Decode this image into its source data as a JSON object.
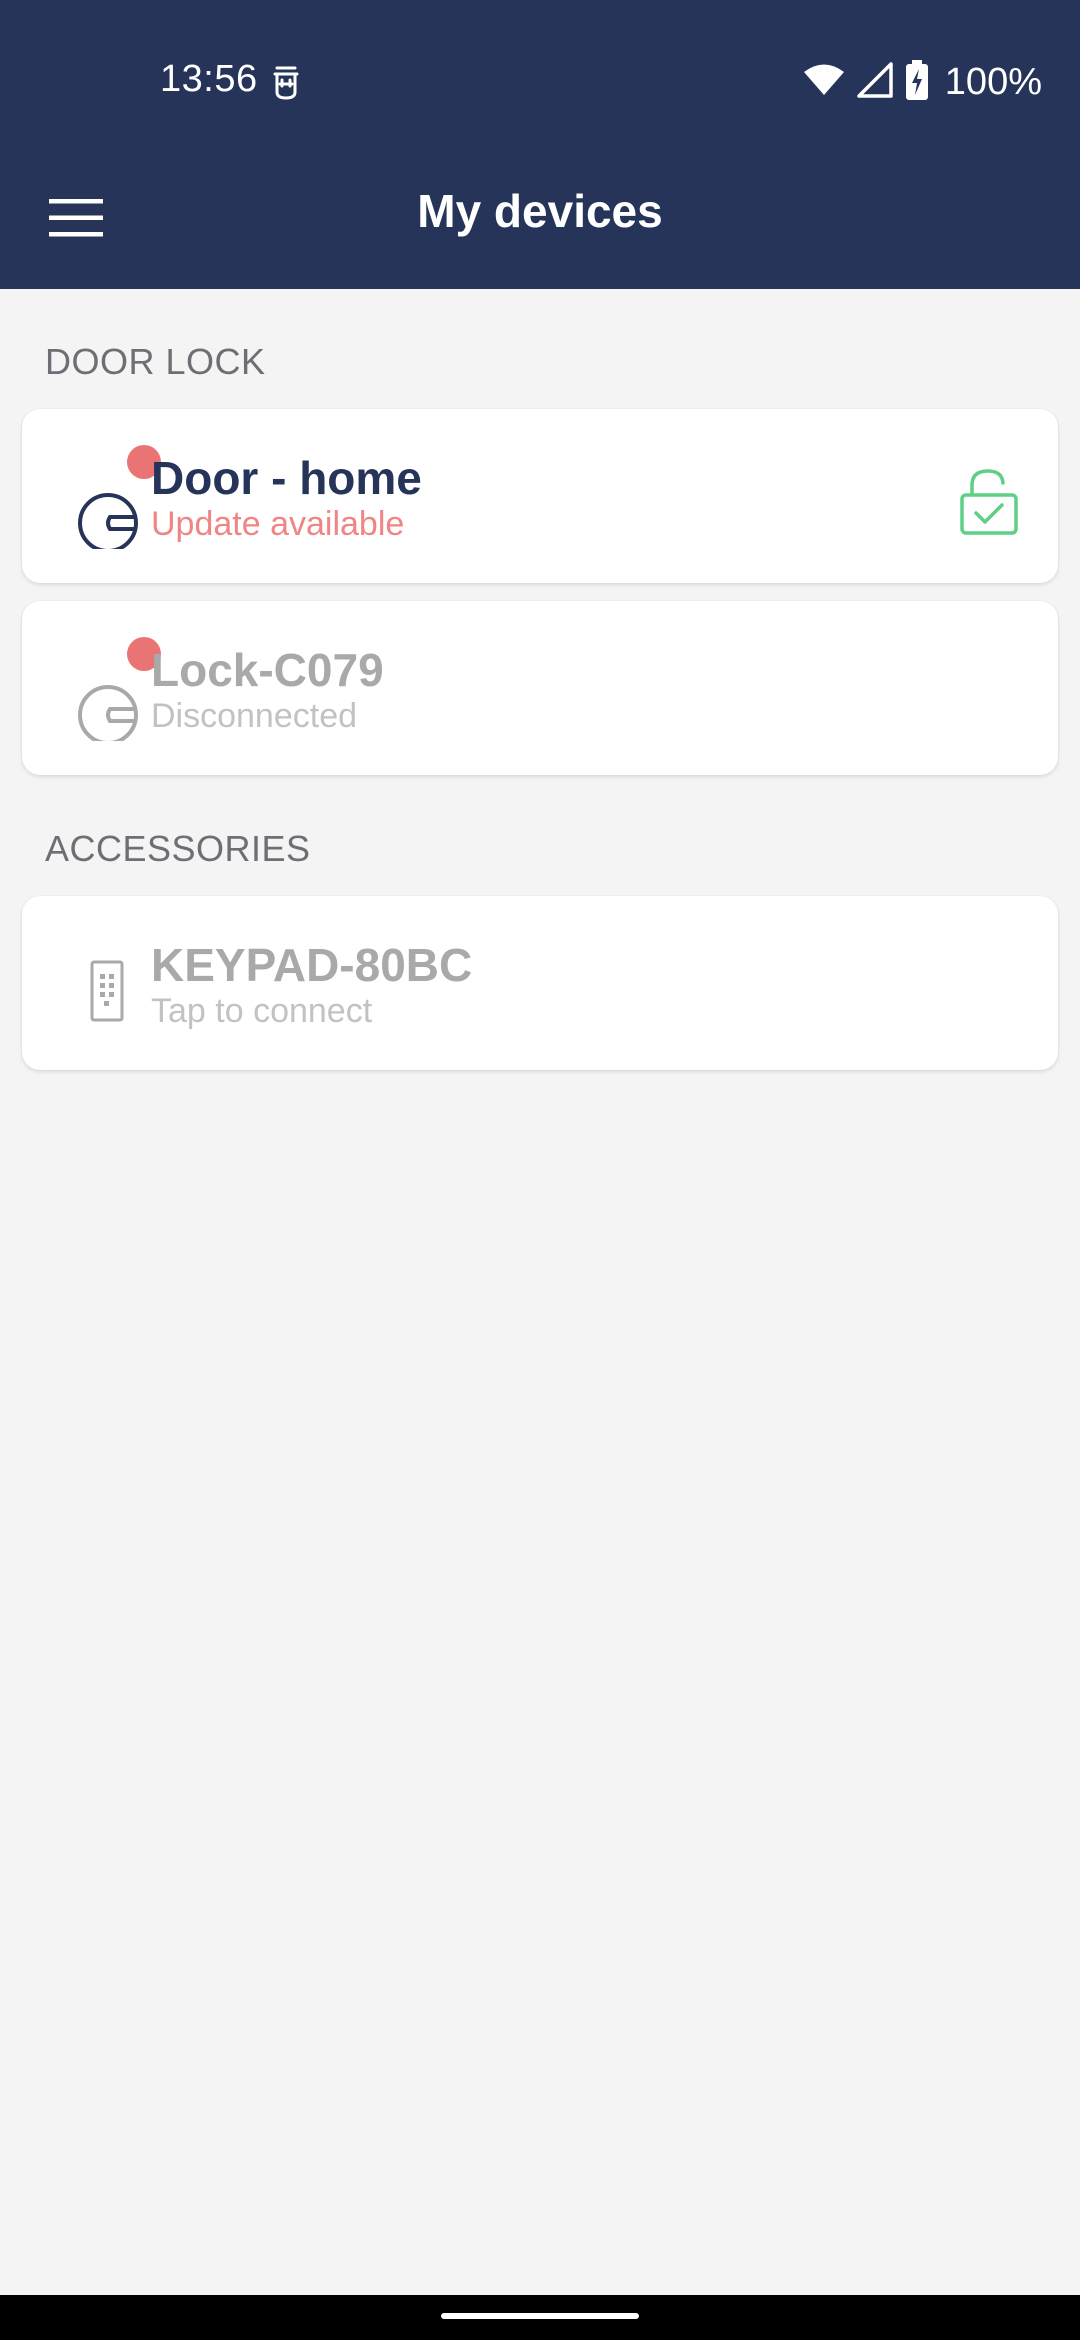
{
  "status_bar": {
    "time": "13:56",
    "battery_percent": "100%",
    "icons": [
      "notification-icon",
      "wifi-icon",
      "signal-icon",
      "battery-charging-icon"
    ]
  },
  "toolbar": {
    "title": "My devices",
    "menu_icon": "hamburger-menu-icon"
  },
  "sections": {
    "door_lock": {
      "label": "DOOR LOCK",
      "devices": [
        {
          "name": "Door - home",
          "status": "Update available",
          "icon": "door-lock-icon",
          "has_alert_badge": true,
          "lock_state_icon": "unlocked-check-icon"
        },
        {
          "name": "Lock-C079",
          "status": "Disconnected",
          "icon": "door-lock-icon",
          "has_alert_badge": true
        }
      ]
    },
    "accessories": {
      "label": "ACCESSORIES",
      "devices": [
        {
          "name": "KEYPAD-80BC",
          "status": "Tap to connect",
          "icon": "keypad-icon"
        }
      ]
    }
  },
  "colors": {
    "header_bg": "#253458",
    "page_bg": "#f4f4f5",
    "alert_badge": "#ea7474",
    "update_text": "#ef8585",
    "unlocked_green": "#5fcf86",
    "muted_text": "#a9a9ac"
  }
}
